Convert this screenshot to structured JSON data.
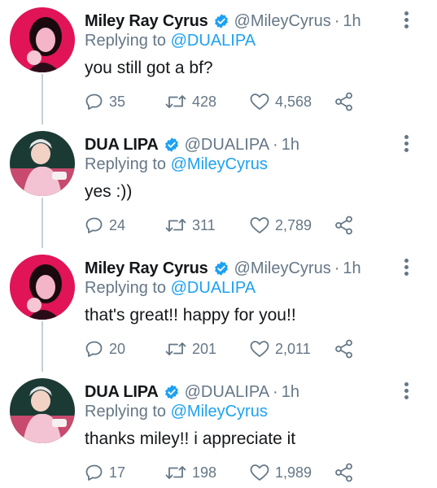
{
  "colors": {
    "name_text": "#14171a",
    "secondary_text": "#657786",
    "mention": "#1da1f2",
    "verified_badge": "#1da1f2",
    "thread_line": "#c4cfd6"
  },
  "tweets": [
    {
      "display_name": "Miley Ray Cyrus",
      "handle": "@MileyCyrus",
      "separator": "·",
      "time": "1h",
      "replying_prefix": "Replying to",
      "replying_to": "@DUALIPA",
      "text": "you still got a bf?",
      "replies": "35",
      "retweets": "428",
      "likes": "4,568",
      "avatar_icon": "miley-avatar"
    },
    {
      "display_name": "DUA LIPA",
      "handle": "@DUALIPA",
      "separator": "·",
      "time": "1h",
      "replying_prefix": "Replying to",
      "replying_to": "@MileyCyrus",
      "text": "yes :))",
      "replies": "24",
      "retweets": "311",
      "likes": "2,789",
      "avatar_icon": "dua-avatar"
    },
    {
      "display_name": "Miley Ray Cyrus",
      "handle": "@MileyCyrus",
      "separator": "·",
      "time": "1h",
      "replying_prefix": "Replying to",
      "replying_to": "@DUALIPA",
      "text": "that's great!! happy for you!!",
      "replies": "20",
      "retweets": "201",
      "likes": "2,011",
      "avatar_icon": "miley-avatar"
    },
    {
      "display_name": "DUA LIPA",
      "handle": "@DUALIPA",
      "separator": "·",
      "time": "1h",
      "replying_prefix": "Replying to",
      "replying_to": "@MileyCyrus",
      "text": "thanks miley!! i appreciate it",
      "replies": "17",
      "retweets": "198",
      "likes": "1,989",
      "avatar_icon": "dua-avatar"
    }
  ]
}
